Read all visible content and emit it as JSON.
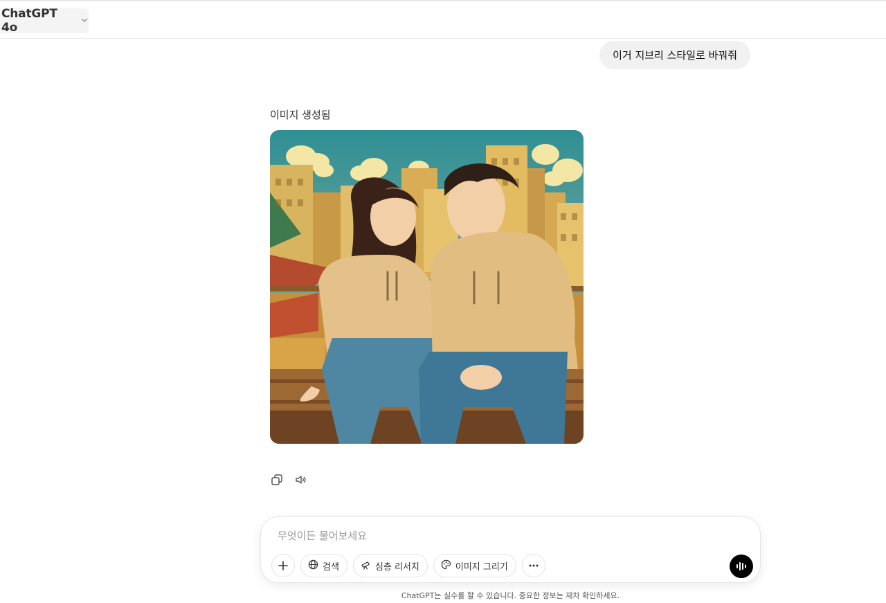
{
  "header": {
    "model_name": "ChatGPT 4o",
    "chevron_icon": "chevron-down-icon"
  },
  "conversation": {
    "user_message": "이거 지브리 스타일로 바꿔줘",
    "assistant": {
      "status_label": "이미지 생성됨",
      "image_alt": "이미지 생성됨",
      "actions": [
        {
          "icon": "copy-icon"
        },
        {
          "icon": "speaker-icon"
        }
      ]
    }
  },
  "composer": {
    "placeholder": "무엇이든 물어보세요",
    "add_icon": "plus-icon",
    "tools": [
      {
        "label": "검색",
        "icon": "globe-icon"
      },
      {
        "label": "심층 리서치",
        "icon": "telescope-icon"
      },
      {
        "label": "이미지 그리기",
        "icon": "palette-icon"
      }
    ],
    "more_icon": "more-dots-icon",
    "voice_icon": "voice-mode-icon"
  },
  "footer": {
    "disclaimer": "ChatGPT는 실수를 할 수 있습니다. 중요한 정보는 재차 확인하세요."
  }
}
